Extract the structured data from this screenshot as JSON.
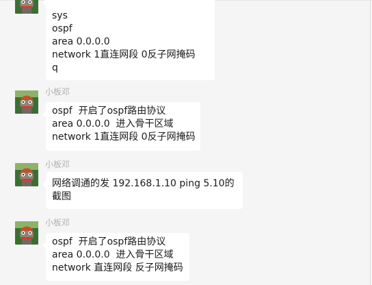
{
  "messages": [
    {
      "sender": "",
      "lines": [
        "sys",
        "ospf",
        "area 0.0.0.0",
        "network 1直连网段 0反子网掩码",
        "q"
      ]
    },
    {
      "sender": "小板邓",
      "lines": [
        "ospf  开启了ospf路由协议",
        "area 0.0.0.0  进入骨干区域",
        "network 1直连网段 0反子网掩码"
      ]
    },
    {
      "sender": "小板邓",
      "lines": [
        "网络调通的发 192.168.1.10 ping 5.10的截图"
      ]
    },
    {
      "sender": "小板邓",
      "lines": [
        "ospf  开启了ospf路由协议",
        "area 0.0.0.0  进入骨干区域",
        "network 直连网段 反子网掩码"
      ]
    }
  ],
  "colors": {
    "background": "#f5f5f5",
    "bubble": "#ffffff",
    "sender_name": "#b2b2b2",
    "text": "#1a1a1a"
  }
}
